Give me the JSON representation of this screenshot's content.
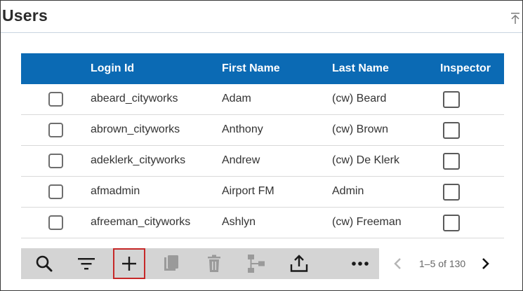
{
  "panel": {
    "title": "Users",
    "collapse_icon": "collapse-up-icon"
  },
  "grid": {
    "columns": {
      "login_id": "Login Id",
      "first_name": "First Name",
      "last_name": "Last Name",
      "inspector": "Inspector"
    },
    "rows": [
      {
        "login_id": "abeard_cityworks",
        "first_name": "Adam",
        "last_name": "(cw) Beard",
        "inspector": false,
        "selected": false
      },
      {
        "login_id": "abrown_cityworks",
        "first_name": "Anthony",
        "last_name": "(cw) Brown",
        "inspector": false,
        "selected": false
      },
      {
        "login_id": "adeklerk_cityworks",
        "first_name": "Andrew",
        "last_name": "(cw) De Klerk",
        "inspector": false,
        "selected": false
      },
      {
        "login_id": "afmadmin",
        "first_name": "Airport FM",
        "last_name": "Admin",
        "inspector": false,
        "selected": false
      },
      {
        "login_id": "afreeman_cityworks",
        "first_name": "Ashlyn",
        "last_name": "(cw) Freeman",
        "inspector": false,
        "selected": false
      }
    ],
    "header_color": "#0b6ab4"
  },
  "toolbar": {
    "buttons": [
      {
        "icon": "search-icon",
        "enabled": true
      },
      {
        "icon": "filter-icon",
        "enabled": true
      },
      {
        "icon": "add-icon",
        "enabled": true,
        "highlighted": true,
        "highlight_color": "#c62828"
      },
      {
        "icon": "copy-icon",
        "enabled": false
      },
      {
        "icon": "delete-icon",
        "enabled": false
      },
      {
        "icon": "hierarchy-icon",
        "enabled": false
      },
      {
        "icon": "export-icon",
        "enabled": true
      },
      {
        "icon": "more-icon",
        "enabled": true
      }
    ]
  },
  "pager": {
    "info": "1–5 of 130",
    "prev_enabled": false,
    "next_enabled": true
  }
}
